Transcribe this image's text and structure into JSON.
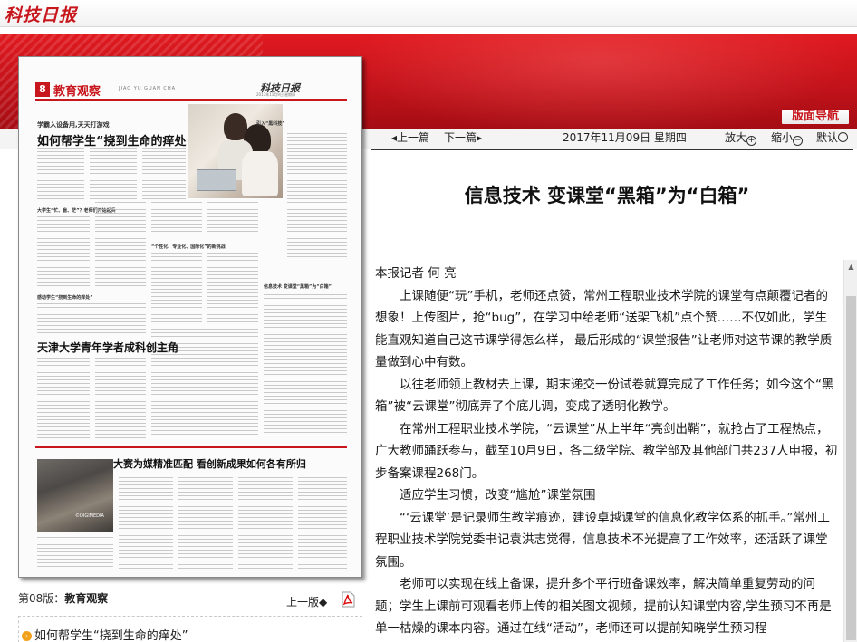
{
  "header": {
    "logo_text": "科技日报"
  },
  "banner": {
    "nav_button": "版面导航"
  },
  "newspaper_page": {
    "page_number": "8",
    "section_title": "教育观察",
    "section_pinyin": "JIAO YU GUAN CHA",
    "masthead": "科技日报",
    "meta_line": "2017年11月9日 星期四",
    "lead_line": "学霸入设备用,天天打游戏",
    "headline_1": "如何帮学生“挠到生命的痒处”",
    "side_title": "引入“黑科技”",
    "sub_1": "大学生“忙、盲、茫”？老师们开始起兵",
    "sub_2": "“个性化、专业化、国际化”的新挑战",
    "sub_3": "感动学生“挠到生命的痒处”",
    "sub_4": "信息技术 变课堂“黑箱”为“白箱”",
    "headline_2": "天津大学青年学者成科创主角",
    "headline_3": "大赛为媒精准匹配 看创新成果如何各有所归",
    "photo2_caption": "©DIGIMEDIA"
  },
  "page_nav": {
    "page_label_prefix": "第08版：",
    "page_label_name": "教育观察",
    "prev_page": "上一版",
    "prev_page_arrow": "◆",
    "article_links": [
      {
        "text": "如何帮学生“挠到生命的痒处”"
      }
    ]
  },
  "toolbar": {
    "prev_article": "上一篇",
    "next_article": "下一篇",
    "date": "2017年11月09日  星期四",
    "zoom_in": "放大",
    "zoom_out": "缩小",
    "default": "默认",
    "zoom_in_sym": "+",
    "zoom_out_sym": "−"
  },
  "article": {
    "title": "信息技术 变课堂“黑箱”为“白箱”",
    "byline": "本报记者  何  亮",
    "paragraphs": [
      "上课随便“玩”手机，老师还点赞，常州工程职业技术学院的课堂有点颠覆记者的想象！上传图片，抢“bug”，在学习中给老师“送架飞机”点个赞……不仅如此，学生能直观知道自己这节课学得怎么样，  最后形成的“课堂报告”让老师对这节课的教学质量做到心中有数。",
      "以往老师领上教材去上课，期末递交一份试卷就算完成了工作任务；如今这个“黑箱”被“云课堂”彻底弄了个底儿调，变成了透明化教学。",
      "在常州工程职业技术学院，“云课堂”从上半年“亮剑出鞘”，就抢占了工程热点，广大教师踊跃参与，截至10月9日，各二级学院、教学部及其他部门共237人申报，初步备案课程268门。",
      "适应学生习惯，改变“尴尬”课堂氛围",
      "“‘云课堂’是记录师生教学痕迹，建设卓越课堂的信息化教学体系的抓手。”常州工程职业技术学院党委书记袁洪志觉得，信息技术不光提高了工作效率，还活跃了课堂氛围。",
      "老师可以实现在线上备课，提升多个平行班备课效率，解决简单重复劳动的问题；学生上课前可观看老师上传的相关图文视频，提前认知课堂内容,学生预习不再是单一枯燥的课本内容。通过在线“活动”，老师还可以提前知晓学生预习程"
    ]
  },
  "colors": {
    "accent": "#c8161d",
    "banner_dark": "#a50d14",
    "bullet": "#f2a11b"
  }
}
